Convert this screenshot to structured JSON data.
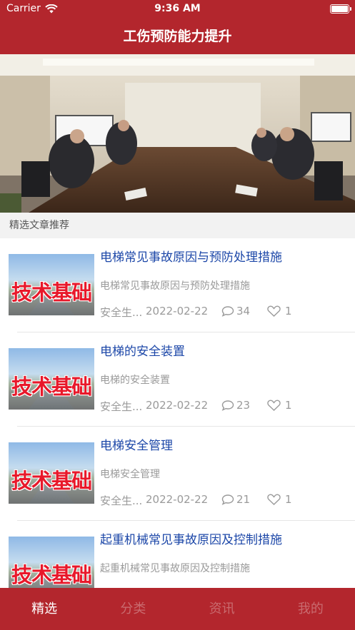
{
  "status_bar": {
    "carrier": "Carrier",
    "time": "9:36 AM"
  },
  "nav": {
    "title": "工伤预防能力提升"
  },
  "section": {
    "title": "精选文章推荐"
  },
  "articles": [
    {
      "title": "电梯常见事故原因与预防处理措施",
      "summary": "电梯常见事故原因与预防处理措施",
      "thumb_text": "技术基础",
      "source": "安全生...",
      "date": "2022-02-22",
      "comments": "34",
      "likes": "1"
    },
    {
      "title": "电梯的安全装置",
      "summary": "电梯的安全装置",
      "thumb_text": "技术基础",
      "source": "安全生...",
      "date": "2022-02-22",
      "comments": "23",
      "likes": "1"
    },
    {
      "title": "电梯安全管理",
      "summary": "电梯安全管理",
      "thumb_text": "技术基础",
      "source": "安全生...",
      "date": "2022-02-22",
      "comments": "21",
      "likes": "1"
    },
    {
      "title": "起重机械常见事故原因及控制措施",
      "summary": "起重机械常见事故原因及控制措施",
      "thumb_text": "技术基础",
      "source": "安全生...",
      "date": "2022-02-22",
      "comments": "",
      "likes": ""
    }
  ],
  "tabs": [
    {
      "label": "精选",
      "active": true
    },
    {
      "label": "分类",
      "active": false
    },
    {
      "label": "资讯",
      "active": false
    },
    {
      "label": "我的",
      "active": false
    }
  ],
  "colors": {
    "brand": "#b3262d",
    "title_blue": "#1c47a8",
    "meta_gray": "#9a9a9a",
    "tab_inactive": "#c96b6f"
  },
  "icons": [
    "wifi-icon",
    "battery-icon",
    "comment-icon",
    "heart-icon"
  ]
}
